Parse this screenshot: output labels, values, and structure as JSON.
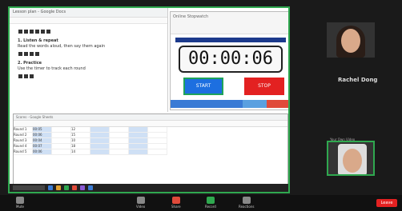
{
  "shared_screen": {
    "doc": {
      "tab_title": "Lesson plan - Google Docs",
      "lines": [
        {
          "text": "1. Listen & repeat",
          "heading": true
        },
        {
          "text": "Read the words aloud, then say them again",
          "heading": false
        },
        {
          "text": "2. Practice",
          "heading": true
        },
        {
          "text": "Use the timer to track each round",
          "heading": false
        }
      ]
    },
    "timer": {
      "title": "Online Stopwatch",
      "display": "00:00:06",
      "start_label": "START",
      "stop_label": "STOP",
      "strip_colors": [
        "#3a7bd5",
        "#3a7bd5",
        "#3a7bd5",
        "#5aa0e0",
        "#e04a3a"
      ]
    },
    "sheet": {
      "tab_title": "Scores - Google Sheets",
      "rows": [
        [
          "Round 1",
          "00:05",
          "",
          "12",
          "",
          "",
          "",
          ""
        ],
        [
          "Round 2",
          "00:06",
          "",
          "15",
          "",
          "",
          "",
          ""
        ],
        [
          "Round 3",
          "00:04",
          "",
          "10",
          "",
          "",
          "",
          ""
        ],
        [
          "Round 4",
          "00:07",
          "",
          "18",
          "",
          "",
          "",
          ""
        ],
        [
          "Round 5",
          "00:06",
          "",
          "14",
          "",
          "",
          "",
          ""
        ]
      ]
    }
  },
  "participants": [
    {
      "name": "Rachel Dong"
    },
    {
      "name": "Your Own Video"
    }
  ],
  "controls": [
    {
      "label": "Mute",
      "name": "mute"
    },
    {
      "label": "Video",
      "name": "video"
    },
    {
      "label": "Share",
      "name": "share"
    },
    {
      "label": "Record",
      "name": "record"
    },
    {
      "label": "Reactions",
      "name": "reactions"
    }
  ],
  "leave_label": "Leave"
}
